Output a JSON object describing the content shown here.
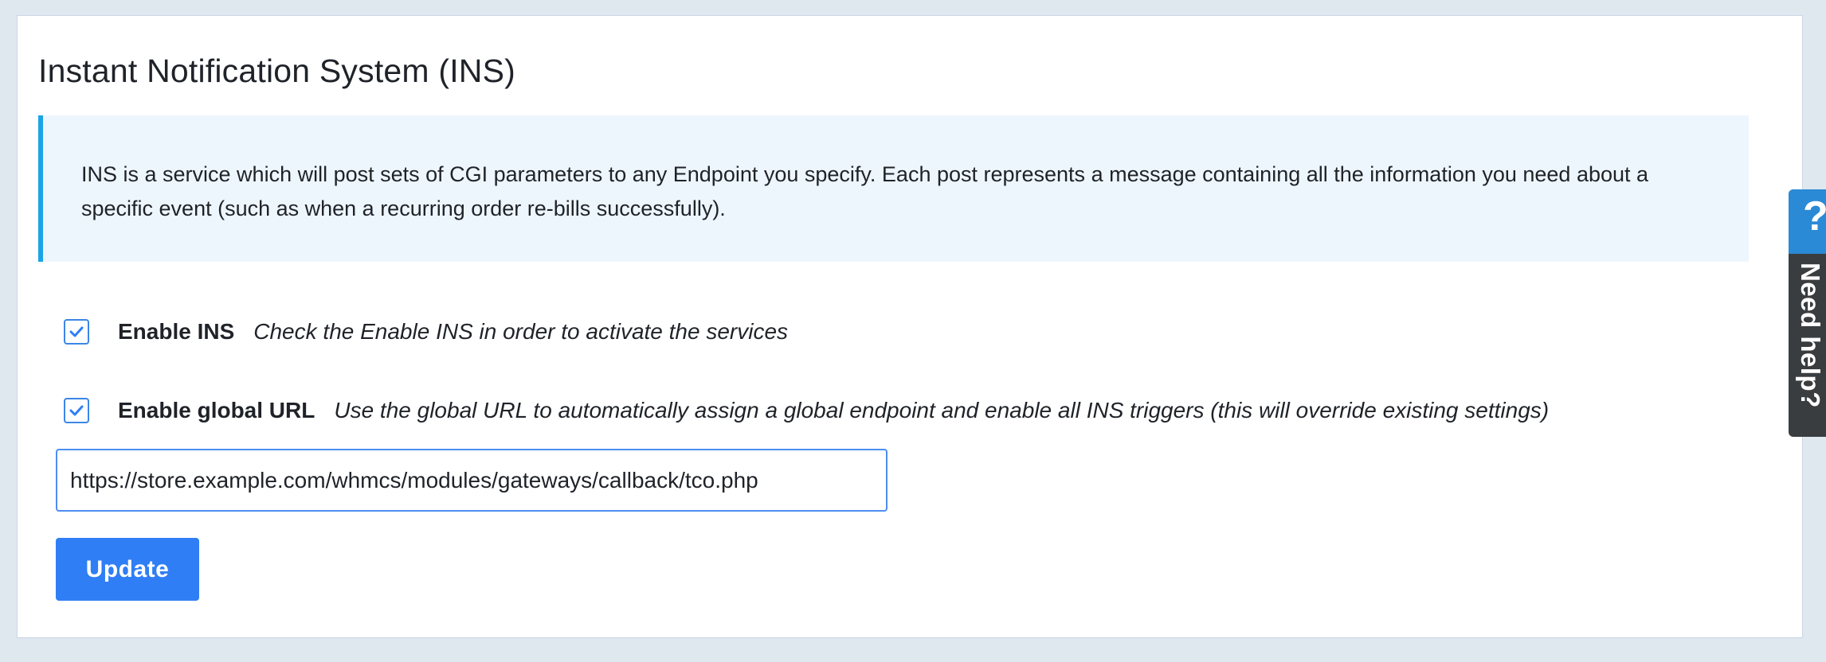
{
  "section": {
    "title": "Instant Notification System (INS)"
  },
  "info_box": {
    "text": "INS is a service which will post sets of CGI parameters to any Endpoint you specify. Each post represents a message containing all the information you need about a specific event (such as when a recurring order re-bills successfully)."
  },
  "enable_ins": {
    "checked": true,
    "label": "Enable INS",
    "help": "Check the Enable INS in order to activate the services"
  },
  "enable_global_url": {
    "checked": true,
    "label": "Enable global URL",
    "help": "Use the global URL to automatically assign a global endpoint and enable all INS triggers (this will override existing settings)"
  },
  "global_url_field": {
    "value": "https://store.example.com/whmcs/modules/gateways/callback/tco.php"
  },
  "update_button": {
    "label": "Update"
  },
  "help_tab": {
    "icon": "?",
    "label": "Need help?"
  },
  "colors": {
    "background": "#dfe7ef",
    "info_box_bg": "#eef6fd",
    "info_box_accent": "#1aa4e8",
    "checkbox_accent": "#3b86e6",
    "primary_button": "#2f7ef5",
    "help_tab_top": "#2b8ad6",
    "help_tab_body": "#3a3d40"
  }
}
